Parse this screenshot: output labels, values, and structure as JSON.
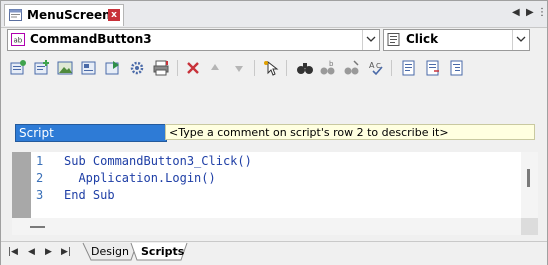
{
  "window": {
    "title": "MenuScreen"
  },
  "object_selector": {
    "value": "CommandButton3",
    "icon": "button-object-icon"
  },
  "event_selector": {
    "value": "Click",
    "icon": "event-list-icon"
  },
  "script_header": {
    "field_value": "Script",
    "comment_hint": "<Type a comment on script's row 2 to describe it>"
  },
  "editor": {
    "line_numbers": [
      "1",
      "2",
      "3"
    ],
    "lines": [
      "Sub CommandButton3_Click()",
      "  Application.Login()",
      "End Sub"
    ]
  },
  "bottom_tabs": {
    "design": "Design",
    "scripts": "Scripts"
  },
  "colors": {
    "selection": "#2e7bd6",
    "comment_bg": "#ffffe0",
    "code": "#1f3fa6",
    "close": "#c8323a"
  }
}
